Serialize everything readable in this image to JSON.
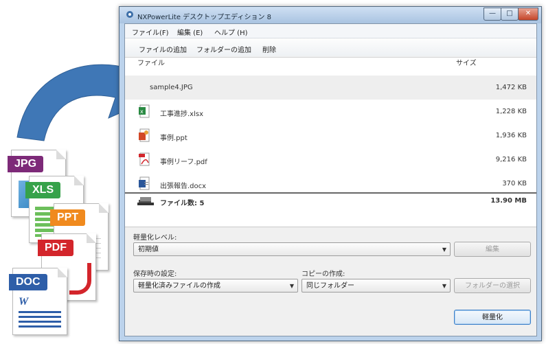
{
  "window": {
    "title": "NXPowerLite デスクトップエディション 8",
    "controls": {
      "minimize": "—",
      "maximize": "□",
      "close": "✕"
    }
  },
  "menu": [
    {
      "label": "ファイル(F)"
    },
    {
      "label": "編集 (E)"
    },
    {
      "label": "ヘルプ (H)"
    }
  ],
  "toolbar": {
    "add_files": "ファイルの追加",
    "add_folder": "フォルダーの追加",
    "delete": "削除"
  },
  "list": {
    "col_file": "ファイル",
    "col_size": "サイズ",
    "rows": [
      {
        "name": "sample4.JPG",
        "size": "1,472 KB",
        "icon": "jpg-file-icon"
      },
      {
        "name": "工事進捗.xlsx",
        "size": "1,228 KB",
        "icon": "excel-file-icon"
      },
      {
        "name": "事例.ppt",
        "size": "1,936 KB",
        "icon": "powerpoint-file-icon"
      },
      {
        "name": "事例リーフ.pdf",
        "size": "9,216 KB",
        "icon": "pdf-file-icon"
      },
      {
        "name": "出張報告.docx",
        "size": "370 KB",
        "icon": "word-file-icon"
      }
    ],
    "total_label": "ファイル数: 5",
    "total_size": "13.90 MB"
  },
  "settings": {
    "level_label": "軽量化レベル:",
    "level_value": "初期値",
    "edit_button": "編集",
    "save_label": "保存時の設定:",
    "save_value": "軽量化済みファイルの作成",
    "copy_label": "コピーの作成:",
    "copy_value": "同じフォルダー",
    "folder_button": "フォルダーの選択",
    "optimize_button": "軽量化"
  },
  "file_badges": {
    "jpg": "JPG",
    "xls": "XLS",
    "ppt": "PPT",
    "pdf": "PDF",
    "doc": "DOC",
    "word_mark": "W"
  },
  "colors": {
    "arrow_blue": "#3f77b6",
    "jpg_purple": "#7d2a78",
    "xls_green": "#36a24a",
    "ppt_orange": "#f08a1e",
    "pdf_red": "#d3252b",
    "doc_blue": "#2e5ea8"
  }
}
